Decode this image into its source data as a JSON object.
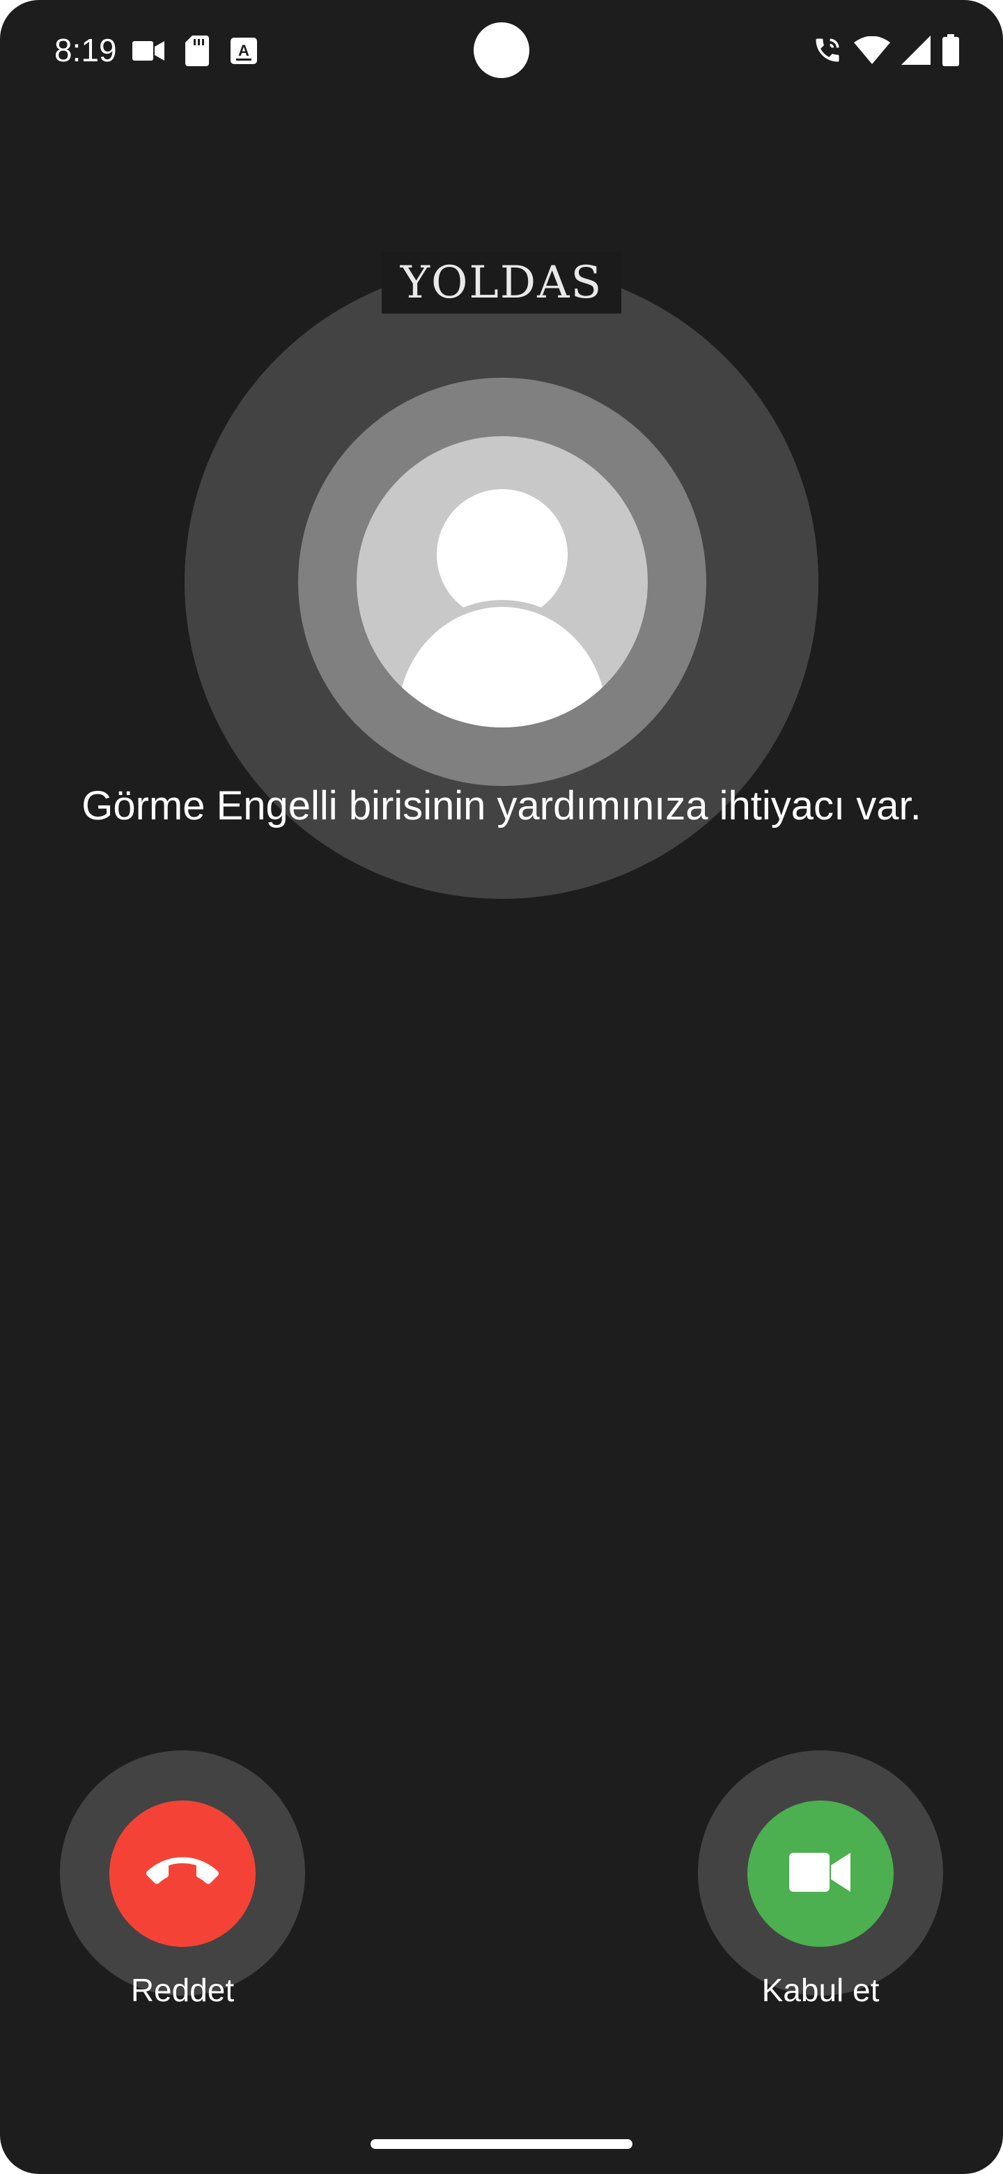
{
  "status_bar": {
    "time": "8:19",
    "left_icons": [
      "video-camera-icon",
      "sd-card-icon",
      "text-recognition-icon"
    ],
    "right_icons": [
      "wifi-calling-icon",
      "wifi-icon",
      "cellular-signal-icon",
      "battery-icon"
    ]
  },
  "caller": {
    "app_logo": "YOLDAS",
    "avatar_icon": "person-silhouette-icon",
    "message": "Görme Engelli birisinin yardımınıza ihtiyacı var."
  },
  "actions": {
    "decline": {
      "label": "Reddet",
      "icon": "hang-up-phone-icon",
      "color": "#f44336"
    },
    "accept": {
      "label": "Kabul et",
      "icon": "video-camera-icon",
      "color": "#4caf50"
    }
  },
  "colors": {
    "background": "#1d1d1d",
    "outer_ring": "#434343",
    "middle_ring": "#808080",
    "avatar_bg": "#c8c8c8"
  }
}
